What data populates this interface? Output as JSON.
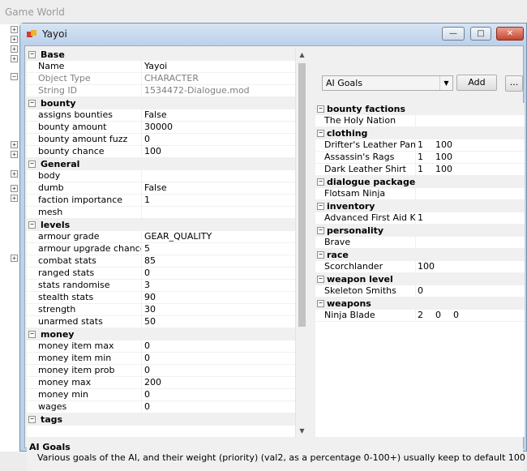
{
  "parent": {
    "title": "Game World"
  },
  "window": {
    "title": "Yayoi",
    "minimize": "—",
    "maximize": "□",
    "close": "✕"
  },
  "left": {
    "categories": [
      {
        "name": "Base",
        "rows": [
          {
            "key": "Name",
            "value": "Yayoi",
            "readonly": false
          },
          {
            "key": "Object Type",
            "value": "CHARACTER",
            "readonly": true
          },
          {
            "key": "String ID",
            "value": "1534472-Dialogue.mod",
            "readonly": true
          }
        ]
      },
      {
        "name": "bounty",
        "rows": [
          {
            "key": "assigns bounties",
            "value": "False"
          },
          {
            "key": "bounty amount",
            "value": "30000"
          },
          {
            "key": "bounty amount fuzz",
            "value": "0"
          },
          {
            "key": "bounty chance",
            "value": "100"
          }
        ]
      },
      {
        "name": "General",
        "rows": [
          {
            "key": "body",
            "value": ""
          },
          {
            "key": "dumb",
            "value": "False"
          },
          {
            "key": "faction importance",
            "value": "1"
          },
          {
            "key": "mesh",
            "value": ""
          }
        ]
      },
      {
        "name": "levels",
        "rows": [
          {
            "key": "armour grade",
            "value": "GEAR_QUALITY"
          },
          {
            "key": "armour upgrade chance",
            "value": "5"
          },
          {
            "key": "combat stats",
            "value": "85"
          },
          {
            "key": "ranged stats",
            "value": "0"
          },
          {
            "key": "stats randomise",
            "value": "3"
          },
          {
            "key": "stealth stats",
            "value": "90"
          },
          {
            "key": "strength",
            "value": "30"
          },
          {
            "key": "unarmed stats",
            "value": "50"
          }
        ]
      },
      {
        "name": "money",
        "rows": [
          {
            "key": "money item max",
            "value": "0"
          },
          {
            "key": "money item min",
            "value": "0"
          },
          {
            "key": "money item prob",
            "value": "0"
          },
          {
            "key": "money max",
            "value": "200"
          },
          {
            "key": "money min",
            "value": "0"
          },
          {
            "key": "wages",
            "value": "0"
          }
        ]
      },
      {
        "name": "tags",
        "rows": []
      }
    ]
  },
  "right": {
    "combo_value": "AI Goals",
    "add_label": "Add",
    "more_label": "...",
    "categories": [
      {
        "name": "bounty factions",
        "rows": [
          {
            "key": "The Holy Nation",
            "vals": []
          }
        ]
      },
      {
        "name": "clothing",
        "rows": [
          {
            "key": "Drifter's Leather Pants",
            "vals": [
              "1",
              "100"
            ]
          },
          {
            "key": "Assassin's Rags",
            "vals": [
              "1",
              "100"
            ]
          },
          {
            "key": "Dark Leather Shirt",
            "vals": [
              "1",
              "100"
            ]
          }
        ]
      },
      {
        "name": "dialogue package",
        "rows": [
          {
            "key": "Flotsam Ninja",
            "vals": []
          }
        ]
      },
      {
        "name": "inventory",
        "rows": [
          {
            "key": "Advanced First Aid Kit",
            "vals": [
              "1"
            ]
          }
        ]
      },
      {
        "name": "personality",
        "rows": [
          {
            "key": "Brave",
            "vals": []
          }
        ]
      },
      {
        "name": "race",
        "rows": [
          {
            "key": "Scorchlander",
            "vals": [
              "100"
            ]
          }
        ]
      },
      {
        "name": "weapon level",
        "rows": [
          {
            "key": "Skeleton Smiths",
            "vals": [
              "0"
            ]
          }
        ]
      },
      {
        "name": "weapons",
        "rows": [
          {
            "key": "Ninja Blade",
            "vals": [
              "2",
              "0",
              "0"
            ]
          }
        ]
      }
    ]
  },
  "help": {
    "title": "AI Goals",
    "description": "Various goals of the AI, and their weight (priority) (val2, as a percentage 0-100+) usually keep to default 100"
  }
}
